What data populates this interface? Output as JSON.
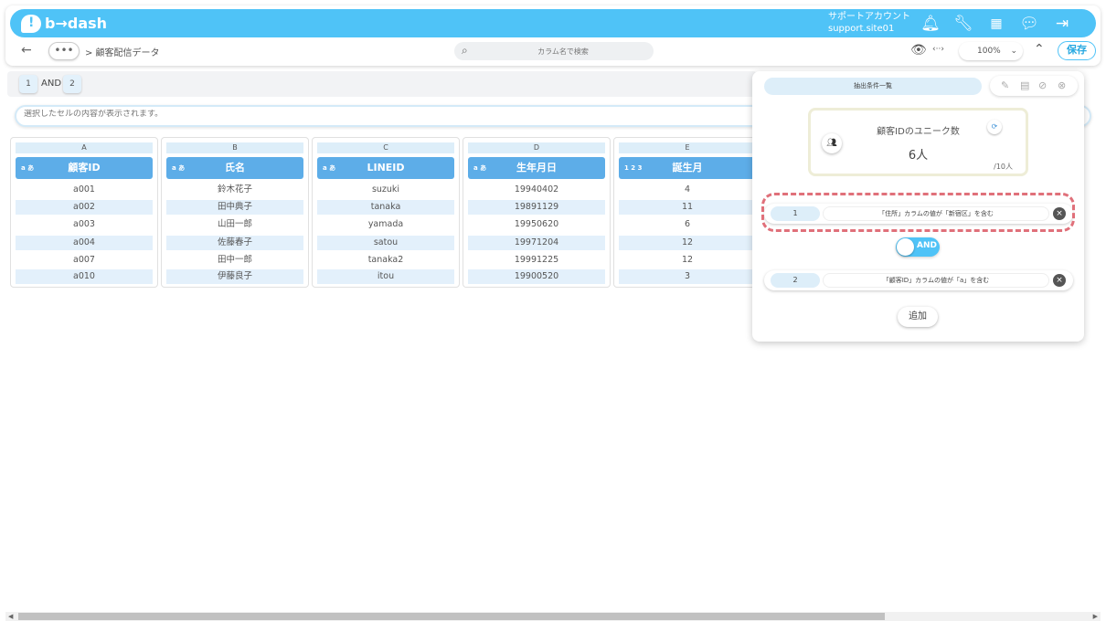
{
  "header": {
    "logo_text": "b→dash",
    "account_name": "サポートアカウント",
    "account_site": "support.site01"
  },
  "subbar": {
    "back": "←",
    "more": "•••",
    "breadcrumb": "> 顧客配信データ",
    "search_placeholder": "カラム名で検索",
    "zoom": "100%",
    "save_label": "保存"
  },
  "cond_bar": {
    "chip1": "1",
    "and": "AND",
    "chip2": "2"
  },
  "cell_display_placeholder": "選択したセルの内容が表示されます。",
  "columns": [
    {
      "letter": "A",
      "type": "a あ",
      "name": "顧客ID",
      "cells": [
        "a001",
        "a002",
        "a003",
        "a004",
        "a007",
        "a010"
      ]
    },
    {
      "letter": "B",
      "type": "a あ",
      "name": "氏名",
      "cells": [
        "鈴木花子",
        "田中典子",
        "山田一郎",
        "佐藤春子",
        "田中一郎",
        "伊藤良子"
      ]
    },
    {
      "letter": "C",
      "type": "a あ",
      "name": "LINEID",
      "cells": [
        "suzuki",
        "tanaka",
        "yamada",
        "satou",
        "tanaka2",
        "itou"
      ]
    },
    {
      "letter": "D",
      "type": "a あ",
      "name": "生年月日",
      "cells": [
        "19940402",
        "19891129",
        "19950620",
        "19971204",
        "19991225",
        "19900520"
      ]
    },
    {
      "letter": "E",
      "type": "1 2 3",
      "name": "誕生月",
      "cells": [
        "4",
        "11",
        "6",
        "12",
        "12",
        "3"
      ]
    }
  ],
  "panel": {
    "tab_label": "抽出条件一覧",
    "unique_title": "顧客IDのユニーク数",
    "unique_value": "6人",
    "unique_total": "/10人",
    "conditions": [
      {
        "num": "1",
        "text": "「住所」カラムの値が「新宿区」を含む"
      },
      {
        "num": "2",
        "text": "「顧客ID」カラムの値が「a」を含む"
      }
    ],
    "and_label": "AND",
    "add_label": "追加"
  }
}
